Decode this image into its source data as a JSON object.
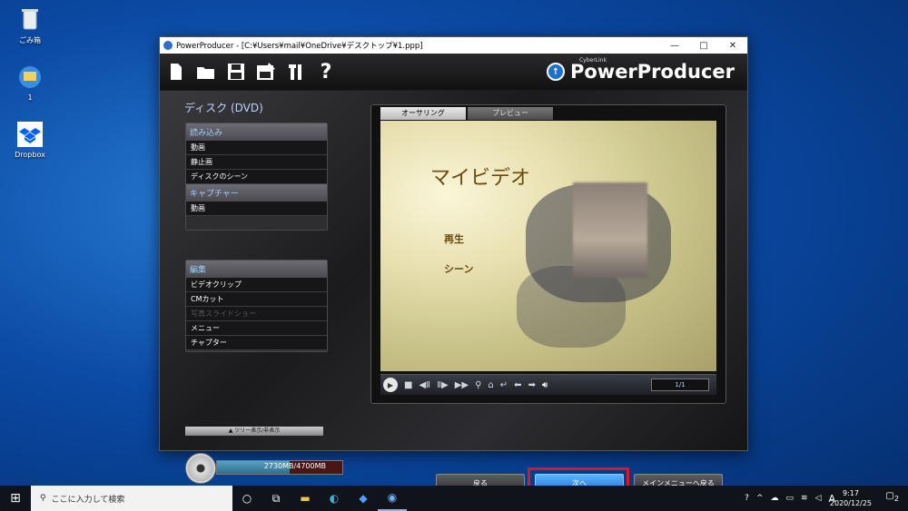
{
  "desktop": {
    "icons": [
      {
        "label": "ごみ箱",
        "icon": "recycle-bin-icon"
      },
      {
        "label": "1",
        "icon": "powerproducer-file-icon"
      },
      {
        "label": "Dropbox",
        "icon": "dropbox-icon"
      }
    ]
  },
  "window": {
    "title": "PowerProducer - [C:¥Users¥mail¥OneDrive¥デスクトップ¥1.ppp]",
    "controls": {
      "minimize": "—",
      "maximize": "□",
      "close": "✕"
    }
  },
  "toolbar": {
    "buttons": [
      "new-icon",
      "open-icon",
      "save-icon",
      "save-as-icon",
      "tools-icon",
      "help-icon"
    ],
    "brand_small": "CyberLink",
    "brand": "PowerProducer"
  },
  "left": {
    "disc_title": "ディスク (DVD)",
    "import_header": "読み込み",
    "import_items": [
      "動画",
      "静止画",
      "ディスクのシーン"
    ],
    "capture_header": "キャプチャー",
    "capture_items": [
      "動画"
    ],
    "edit_header": "編集",
    "edit_items": [
      {
        "label": "ビデオクリップ",
        "disabled": false
      },
      {
        "label": "CMカット",
        "disabled": false
      },
      {
        "label": "写真スライドショー",
        "disabled": true
      },
      {
        "label": "メニュー",
        "disabled": false
      },
      {
        "label": "チャプター",
        "disabled": false
      }
    ],
    "tree_toggle": "ツリー表示/非表示"
  },
  "preview": {
    "tab_authoring": "オーサリング",
    "tab_preview": "プレビュー",
    "menu_title": "マイビデオ",
    "menu_play": "再生",
    "menu_scene": "シーン",
    "page_counter": "1/1"
  },
  "bottom": {
    "capacity_text": "2730MB/4700MB",
    "capacity_fraction": 0.58,
    "back_label": "戻る",
    "next_label": "次へ",
    "main_menu_label": "メインメニューへ戻る"
  },
  "taskbar": {
    "search_placeholder": "ここに入力して検索",
    "ime": "A",
    "time": "9:17",
    "date": "2020/12/25",
    "notification_count": "2"
  }
}
